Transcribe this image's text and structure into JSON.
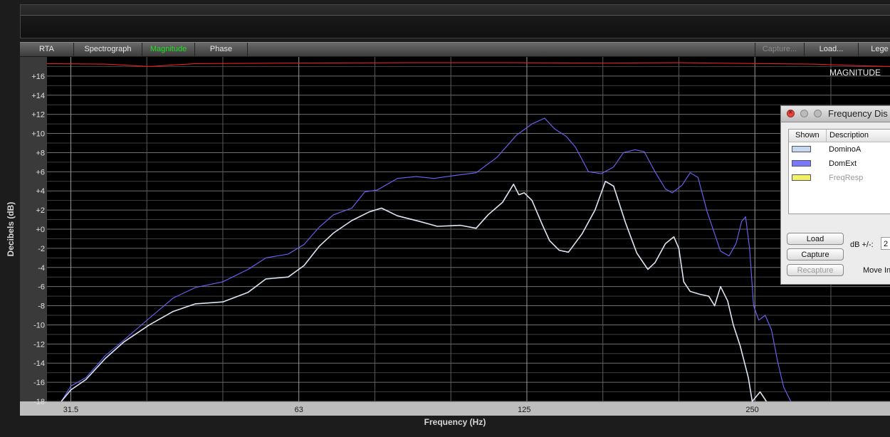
{
  "tabs": [
    {
      "label": "RTA",
      "state": "normal"
    },
    {
      "label": "Spectrograph",
      "state": "normal"
    },
    {
      "label": "Magnitude",
      "state": "active"
    },
    {
      "label": "Phase",
      "state": "normal"
    }
  ],
  "right_buttons": [
    {
      "label": "Capture...",
      "state": "disabled"
    },
    {
      "label": "Load...",
      "state": "normal"
    },
    {
      "label": "Lege",
      "state": "normal"
    }
  ],
  "dialog": {
    "title": "Frequency Dis",
    "columns": [
      "Shown",
      "Description"
    ],
    "items": [
      {
        "name": "DominoA",
        "color": "#c6d8f4",
        "dim": false
      },
      {
        "name": "DomExt",
        "color": "#7a78ff",
        "dim": false
      },
      {
        "name": "FreqResp",
        "color": "#f3f06a",
        "dim": true
      }
    ],
    "load_label": "Load",
    "capture_label": "Capture",
    "recapture_label": "Recapture",
    "db_label": "dB +/-:",
    "db_value": "2",
    "move_label": "Move In"
  },
  "chart_data": {
    "type": "line",
    "title": "MAGNITUDE",
    "xlabel": "Frequency (Hz)",
    "ylabel": "Decibels (dB)",
    "xscale": "log",
    "xlim": [
      29.3,
      380
    ],
    "ylim": [
      -18,
      18
    ],
    "x_ticks": [
      31.5,
      63,
      125,
      250
    ],
    "x_tick_labels": [
      "31.5",
      "63",
      "125",
      "250"
    ],
    "y_ticks": [
      -18,
      -16,
      -14,
      -12,
      -10,
      -8,
      -6,
      -4,
      -2,
      0,
      2,
      4,
      6,
      8,
      10,
      12,
      14,
      16
    ],
    "y_tick_labels": [
      "-18",
      "-16",
      "-14",
      "-12",
      "-10",
      "-8",
      "-6",
      "-4",
      "-2",
      "+0",
      "+2",
      "+4",
      "+6",
      "+8",
      "+10",
      "+12",
      "+14",
      "+16"
    ],
    "grid": true,
    "series": [
      {
        "name": "DominoA",
        "color": "#dce6f4",
        "points": [
          [
            30.6,
            -18
          ],
          [
            31.5,
            -16.8
          ],
          [
            33,
            -15.7
          ],
          [
            35,
            -13.5
          ],
          [
            37,
            -11.8
          ],
          [
            40,
            -10
          ],
          [
            43,
            -8.6
          ],
          [
            46,
            -7.8
          ],
          [
            50,
            -7.6
          ],
          [
            54,
            -6.6
          ],
          [
            57,
            -5.2
          ],
          [
            61,
            -5
          ],
          [
            64,
            -3.8
          ],
          [
            67,
            -1.8
          ],
          [
            70,
            -0.4
          ],
          [
            74,
            0.9
          ],
          [
            78,
            1.8
          ],
          [
            81,
            2.2
          ],
          [
            85,
            1.4
          ],
          [
            91,
            0.8
          ],
          [
            96,
            0.3
          ],
          [
            103,
            0.4
          ],
          [
            108,
            0.1
          ],
          [
            112,
            1.5
          ],
          [
            117,
            2.8
          ],
          [
            121,
            4.7
          ],
          [
            123,
            3.6
          ],
          [
            125,
            3.8
          ],
          [
            128,
            3.0
          ],
          [
            132,
            0.5
          ],
          [
            135,
            -1.2
          ],
          [
            139,
            -2.2
          ],
          [
            143,
            -2.4
          ],
          [
            149,
            -0.5
          ],
          [
            155,
            2.0
          ],
          [
            160,
            5.0
          ],
          [
            164,
            4.5
          ],
          [
            170,
            0.7
          ],
          [
            176,
            -2.5
          ],
          [
            182,
            -4.2
          ],
          [
            186,
            -3.5
          ],
          [
            192,
            -1.5
          ],
          [
            197,
            -0.8
          ],
          [
            200,
            -2.0
          ],
          [
            203,
            -5.5
          ],
          [
            207,
            -6.5
          ],
          [
            213,
            -6.8
          ],
          [
            219,
            -7.0
          ],
          [
            223,
            -8.0
          ],
          [
            227,
            -6.0
          ],
          [
            232,
            -7.5
          ],
          [
            236,
            -10.0
          ],
          [
            241,
            -12.2
          ],
          [
            247,
            -15.5
          ],
          [
            250,
            -18
          ],
          [
            256,
            -17.0
          ],
          [
            261,
            -18
          ]
        ]
      },
      {
        "name": "DomExt",
        "color": "#6a66ff",
        "points": [
          [
            30.6,
            -18
          ],
          [
            31.5,
            -16.4
          ],
          [
            33,
            -15.5
          ],
          [
            35,
            -13.2
          ],
          [
            37,
            -11.6
          ],
          [
            40,
            -9.3
          ],
          [
            43,
            -7.2
          ],
          [
            46,
            -6.1
          ],
          [
            50,
            -5.5
          ],
          [
            54,
            -4.2
          ],
          [
            57,
            -3.0
          ],
          [
            61,
            -2.6
          ],
          [
            64,
            -1.6
          ],
          [
            67,
            0.2
          ],
          [
            70,
            1.5
          ],
          [
            74,
            2.2
          ],
          [
            77,
            3.9
          ],
          [
            80,
            4.1
          ],
          [
            85,
            5.3
          ],
          [
            90,
            5.5
          ],
          [
            95,
            5.3
          ],
          [
            101,
            5.6
          ],
          [
            108,
            5.9
          ],
          [
            115,
            7.5
          ],
          [
            122,
            9.8
          ],
          [
            128,
            11.0
          ],
          [
            133,
            11.6
          ],
          [
            137,
            10.5
          ],
          [
            142,
            9.7
          ],
          [
            146,
            8.6
          ],
          [
            152,
            6.0
          ],
          [
            158,
            5.8
          ],
          [
            164,
            6.5
          ],
          [
            169,
            8.0
          ],
          [
            175,
            8.3
          ],
          [
            180,
            8.1
          ],
          [
            186,
            6.0
          ],
          [
            192,
            4.2
          ],
          [
            196,
            3.8
          ],
          [
            202,
            4.6
          ],
          [
            207,
            5.9
          ],
          [
            212,
            5.4
          ],
          [
            218,
            1.8
          ],
          [
            223,
            -0.5
          ],
          [
            227,
            -2.3
          ],
          [
            233,
            -2.8
          ],
          [
            238,
            -1.5
          ],
          [
            242,
            0.8
          ],
          [
            245,
            1.3
          ],
          [
            248,
            -2.0
          ],
          [
            251,
            -8.0
          ],
          [
            255,
            -9.5
          ],
          [
            260,
            -9.0
          ],
          [
            265,
            -10.5
          ],
          [
            270,
            -13.8
          ],
          [
            275,
            -16.5
          ],
          [
            281,
            -18
          ]
        ]
      },
      {
        "name": "FreqResp",
        "color": "#e8201c",
        "points": [
          [
            29.3,
            17.3
          ],
          [
            35,
            17.25
          ],
          [
            40,
            17.0
          ],
          [
            46,
            17.3
          ],
          [
            60,
            17.35
          ],
          [
            90,
            17.4
          ],
          [
            120,
            17.4
          ],
          [
            160,
            17.35
          ],
          [
            200,
            17.4
          ],
          [
            260,
            17.3
          ],
          [
            300,
            17.25
          ],
          [
            340,
            17.1
          ],
          [
            380,
            17.0
          ]
        ]
      }
    ]
  }
}
